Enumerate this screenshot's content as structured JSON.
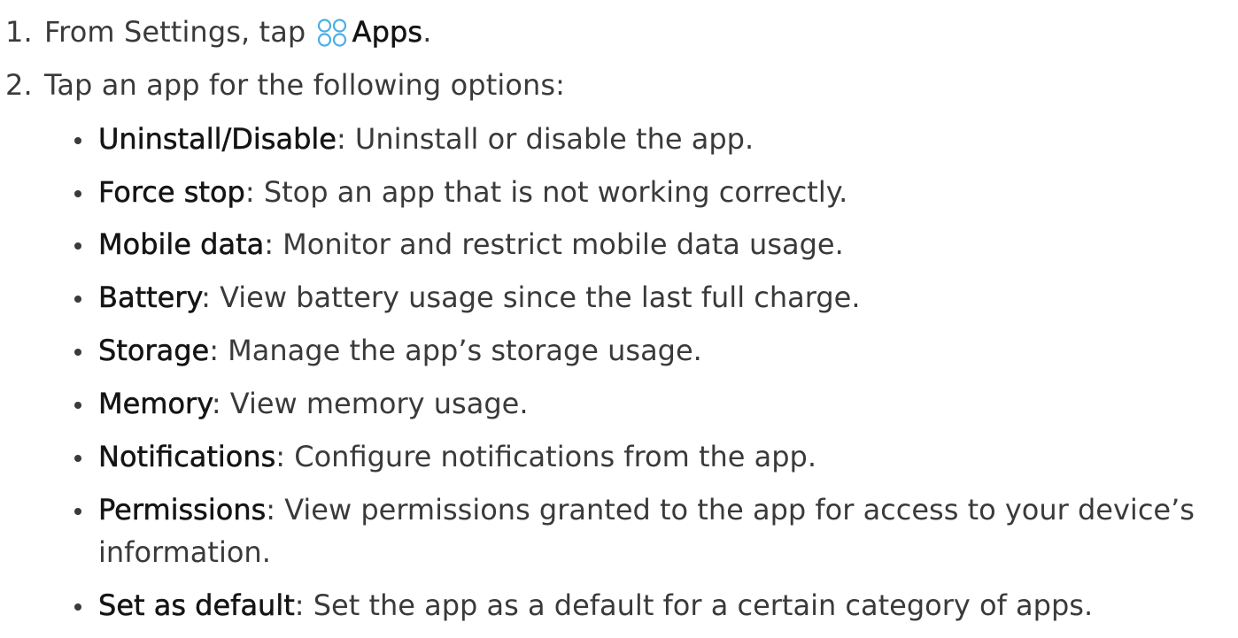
{
  "steps": [
    {
      "number": "1.",
      "prefix": "From Settings, tap",
      "icon": "apps-icon",
      "bold": "Apps",
      "suffix": "."
    },
    {
      "number": "2.",
      "text": "Tap an app for the following options:"
    }
  ],
  "options": [
    {
      "term": "Uninstall/Disable",
      "desc": ": Uninstall or disable the app."
    },
    {
      "term": "Force stop",
      "desc": ": Stop an app that is not working correctly."
    },
    {
      "term": "Mobile data",
      "desc": ": Monitor and restrict mobile data usage."
    },
    {
      "term": "Battery",
      "desc": ": View battery usage since the last full charge."
    },
    {
      "term": "Storage",
      "desc": ": Manage the app’s storage usage."
    },
    {
      "term": "Memory",
      "desc": ": View memory usage."
    },
    {
      "term": "Notifications",
      "desc": ": Configure notifications from the app."
    },
    {
      "term": "Permissions",
      "desc": ": View permissions granted to the app for access to your device’s",
      "continuation": "information."
    },
    {
      "term": "Set as default",
      "desc": ": Set the app as a default for a certain category of apps."
    }
  ],
  "colors": {
    "icon_accent": "#4aaee3",
    "text": "#3a3a3a",
    "bold_text": "#141414"
  }
}
